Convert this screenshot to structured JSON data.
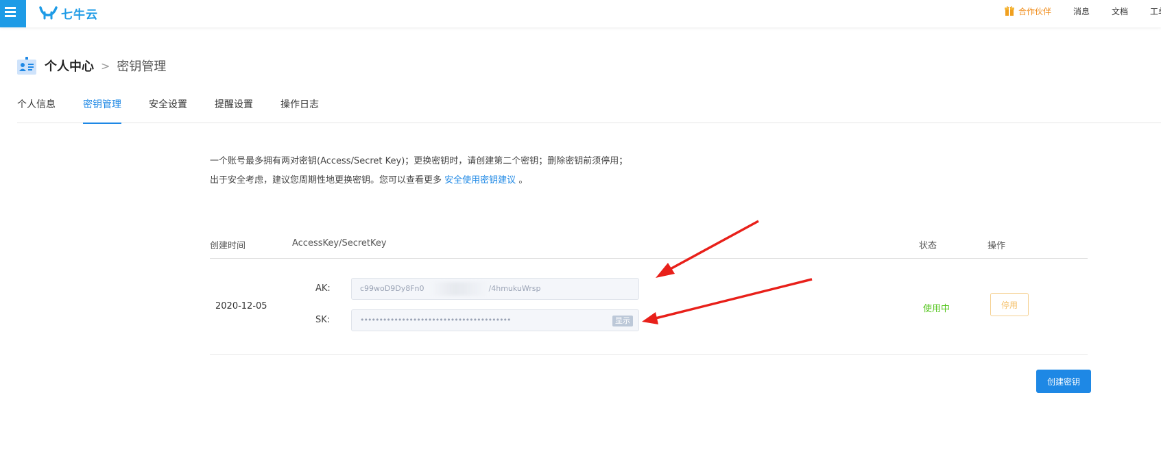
{
  "topbar": {
    "logo_text": "七牛云",
    "partner_label": "合作伙伴",
    "messages_label": "消息",
    "docs_label": "文档",
    "tickets_label": "工单"
  },
  "breadcrumb": {
    "main": "个人中心",
    "separator": ">",
    "current": "密钥管理"
  },
  "tabs": [
    {
      "label": "个人信息",
      "active": false
    },
    {
      "label": "密钥管理",
      "active": true
    },
    {
      "label": "安全设置",
      "active": false
    },
    {
      "label": "提醒设置",
      "active": false
    },
    {
      "label": "操作日志",
      "active": false
    }
  ],
  "description": {
    "text1": "一个账号最多拥有两对密钥(Access/Secret Key)；更换密钥时，请创建第二个密钥；删除密钥前须停用；出于安全考虑，建议您周期性地更换密钥。您可以查看更多",
    "link": "安全使用密钥建议",
    "text2": "。"
  },
  "table": {
    "headers": {
      "created": "创建时间",
      "keys": "AccessKey/SecretKey",
      "status": "状态",
      "actions": "操作"
    },
    "rows": [
      {
        "date": "2020-12-05",
        "ak_label": "AK:",
        "ak_prefix": "c99woD9Dy8Fn0",
        "ak_suffix": "/4hmukuWrsp",
        "sk_label": "SK:",
        "sk_masked": "••••••••••••••••••••••••••••••••••••••••",
        "show_label": "显示",
        "status": "使用中",
        "action_label": "停用"
      }
    ]
  },
  "create_button": "创建密钥",
  "colors": {
    "accent": "#1e88e5",
    "logo": "#1e9be6",
    "partner": "#f08c1a",
    "status_active": "#52c41a",
    "arrow": "#e8201a"
  }
}
